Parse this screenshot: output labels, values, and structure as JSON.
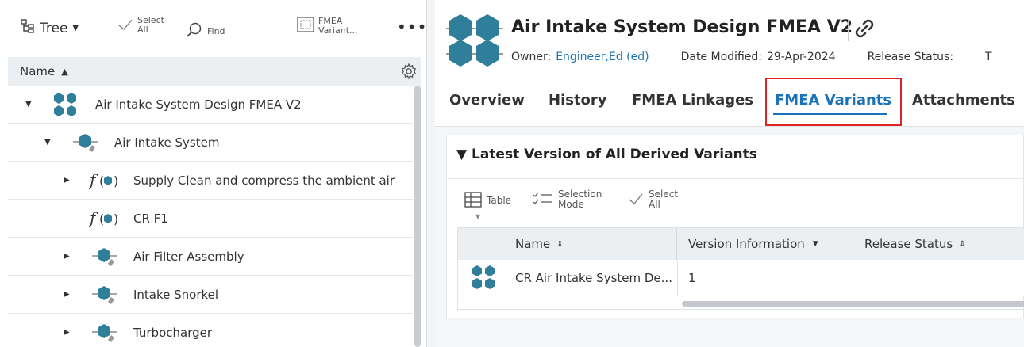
{
  "left_toolbar": {
    "tree_label": "Tree",
    "select_all_line1": "Select",
    "select_all_line2": "All",
    "find_label": "Find",
    "fmea_variants_line1": "FMEA",
    "fmea_variants_line2": "Variant...",
    "more_label": "•••"
  },
  "tree_header": {
    "name_label": "Name"
  },
  "tree": {
    "rows": [
      {
        "label": "Air Intake System Design FMEA V2",
        "icon": "fmea-icon",
        "expanded": true
      },
      {
        "label": "Air Intake System",
        "icon": "system-icon",
        "expanded": true
      },
      {
        "label": "Supply Clean and compress the ambient air",
        "icon": "function-icon",
        "expanded": false
      },
      {
        "label": "CR F1",
        "icon": "function-icon",
        "expanded": null
      },
      {
        "label": "Air Filter Assembly",
        "icon": "system-icon",
        "expanded": false
      },
      {
        "label": "Intake Snorkel",
        "icon": "system-icon",
        "expanded": false
      },
      {
        "label": "Turbocharger",
        "icon": "system-icon",
        "expanded": false
      }
    ]
  },
  "header": {
    "title": "Air Intake System Design FMEA V2",
    "owner_label": "Owner:",
    "owner_value": "Engineer,Ed (ed)",
    "date_label": "Date Modified:",
    "date_value": "29-Apr-2024",
    "release_label": "Release Status:",
    "release_value": "T"
  },
  "tabs": [
    {
      "label": "Overview"
    },
    {
      "label": "History"
    },
    {
      "label": "FMEA Linkages"
    },
    {
      "label": "FMEA Variants",
      "active": true
    },
    {
      "label": "Attachments"
    }
  ],
  "section": {
    "title": "▼ Latest Version of All Derived Variants",
    "table_label": "Table",
    "selection_mode_line1": "Selection",
    "selection_mode_line2": "Mode",
    "select_all_line1": "Select",
    "select_all_line2": "All"
  },
  "grid": {
    "columns": [
      "Name",
      "Version Information",
      "Release Status"
    ],
    "rows": [
      {
        "name": "CR Air Intake System De...",
        "version": "1",
        "release": ""
      }
    ]
  },
  "colors": {
    "accent": "#1a73b8",
    "highlight": "#e02424",
    "icon_teal": "#2f7f9a"
  }
}
